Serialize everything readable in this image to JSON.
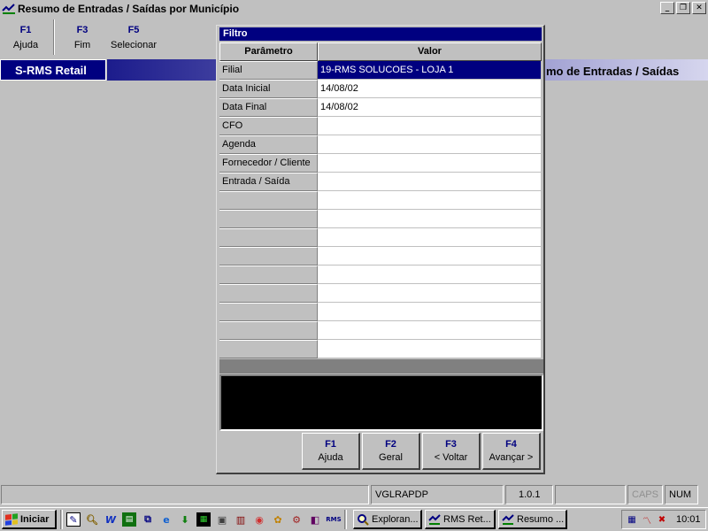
{
  "window": {
    "title": "Resumo de Entradas / Saídas por Município",
    "controls": [
      "_",
      "❐",
      "✕"
    ]
  },
  "function_keys": [
    {
      "key": "F1",
      "label": "Ajuda"
    },
    {
      "key": "F3",
      "label": "Fim"
    },
    {
      "key": "F5",
      "label": "Selecionar"
    }
  ],
  "header": {
    "brand": "S-RMS Retail",
    "screen_title": "mo de Entradas / Saídas"
  },
  "dialog": {
    "title": "Filtro",
    "columns": {
      "parameter": "Parâmetro",
      "value": "Valor"
    },
    "rows": [
      {
        "param": "Filial",
        "value": "19-RMS SOLUCOES - LOJA 1",
        "selected": true
      },
      {
        "param": "Data Inicial",
        "value": "14/08/02"
      },
      {
        "param": "Data Final",
        "value": "14/08/02"
      },
      {
        "param": "CFO",
        "value": ""
      },
      {
        "param": "Agenda",
        "value": ""
      },
      {
        "param": "Fornecedor / Cliente",
        "value": ""
      },
      {
        "param": "Entrada / Saída",
        "value": ""
      },
      {
        "param": "",
        "value": ""
      },
      {
        "param": "",
        "value": ""
      },
      {
        "param": "",
        "value": ""
      },
      {
        "param": "",
        "value": ""
      },
      {
        "param": "",
        "value": ""
      },
      {
        "param": "",
        "value": ""
      },
      {
        "param": "",
        "value": ""
      },
      {
        "param": "",
        "value": ""
      },
      {
        "param": "",
        "value": ""
      }
    ],
    "buttons": [
      {
        "key": "F1",
        "label": "Ajuda"
      },
      {
        "key": "F2",
        "label": "Geral"
      },
      {
        "key": "F3",
        "label": "< Voltar"
      },
      {
        "key": "F4",
        "label": "Avançar >"
      }
    ]
  },
  "statusbar": {
    "program": "VGLRAPDP",
    "version": "1.0.1",
    "caps": "CAPS",
    "num": "NUM"
  },
  "taskbar": {
    "start_label": "Iniciar",
    "tasks": [
      "Exploran...",
      "RMS Ret...",
      "Resumo ..."
    ],
    "clock": "10:01"
  },
  "colors": {
    "selection": "#000080",
    "face": "#c0c0c0"
  }
}
